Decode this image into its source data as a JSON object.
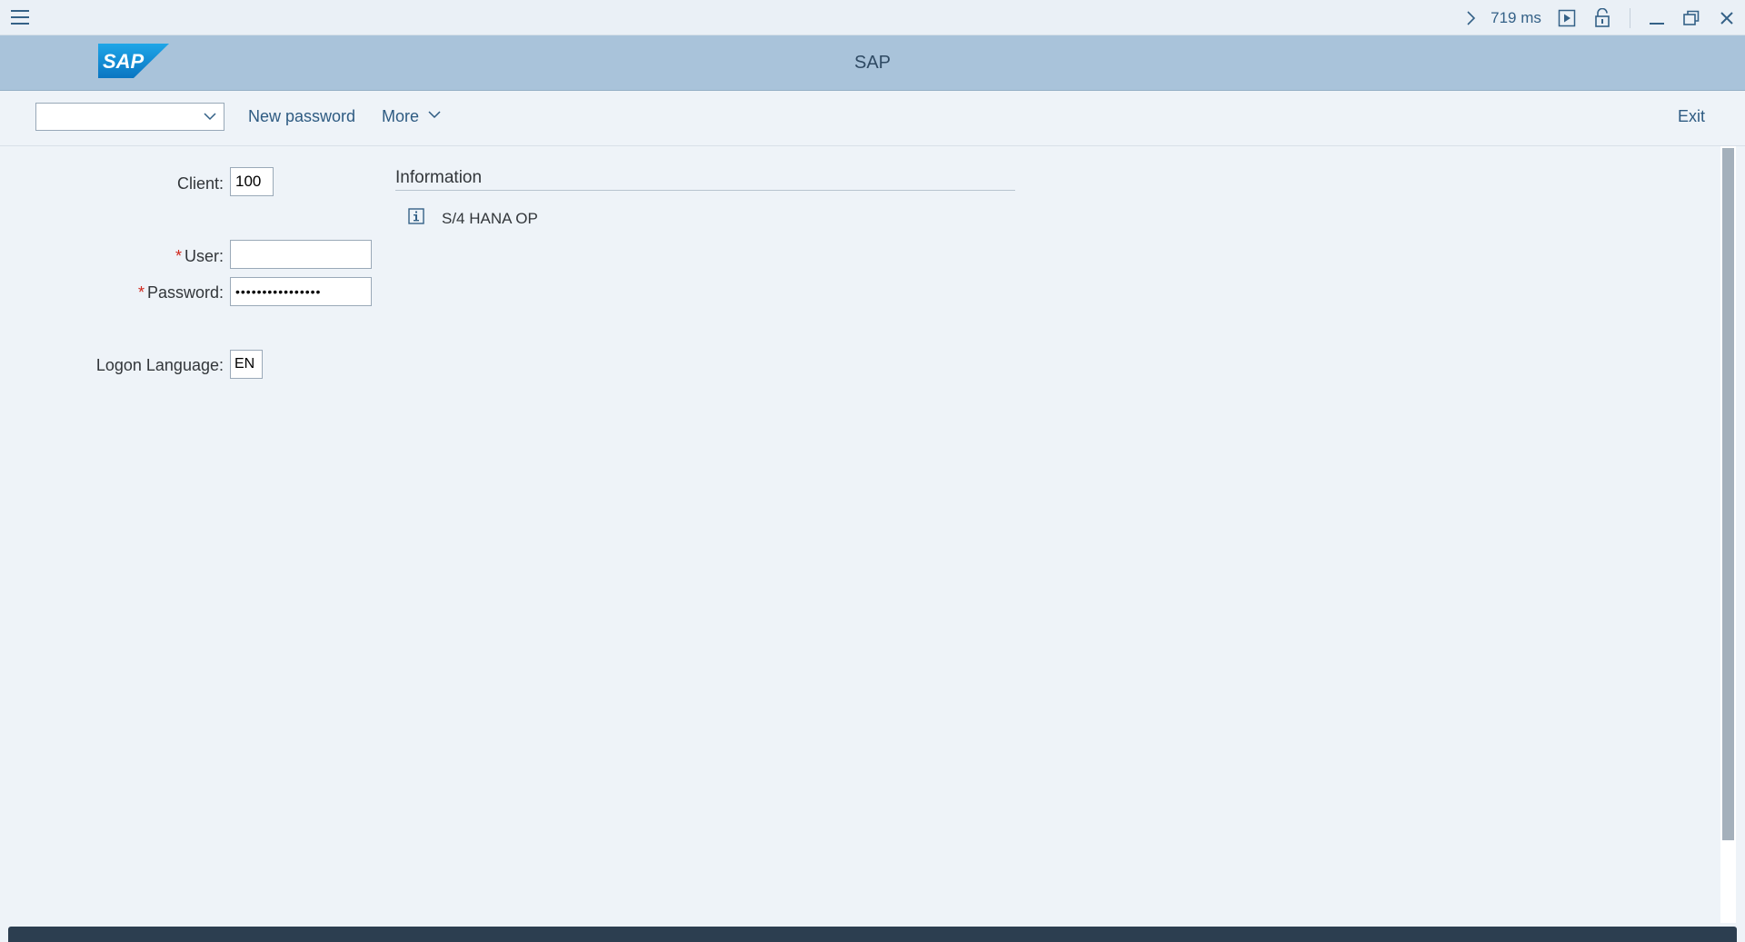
{
  "titlebar": {
    "response_time": "719 ms",
    "icons": [
      "menu-icon",
      "chevron-right-icon",
      "play-icon",
      "unlock-icon",
      "minimize-icon",
      "restore-icon",
      "close-icon"
    ]
  },
  "header": {
    "logo_text": "SAP",
    "title": "SAP"
  },
  "toolbar": {
    "command_field_value": "",
    "new_password_label": "New password",
    "more_label": "More",
    "exit_label": "Exit"
  },
  "form": {
    "client_label": "Client:",
    "client_value": "100",
    "user_label": "User:",
    "user_value": "",
    "password_label": "Password:",
    "password_value": "••••••••••••••••",
    "language_label": "Logon Language:",
    "language_value": "EN",
    "required_marker": "*"
  },
  "information": {
    "title": "Information",
    "items": [
      {
        "icon": "info-icon",
        "text": "S/4 HANA OP"
      }
    ]
  },
  "colors": {
    "header_bg": "#a9c3da",
    "page_bg": "#eef3f8",
    "accent": "#346187",
    "required": "#d0271d",
    "logo_blue": "#0a8fd9"
  }
}
